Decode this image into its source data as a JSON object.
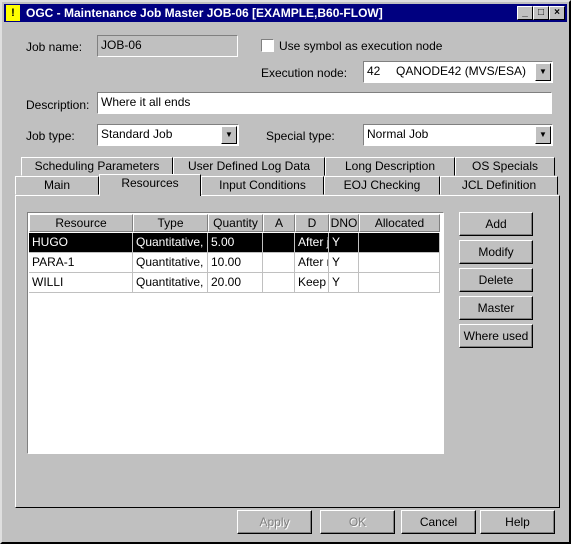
{
  "window": {
    "title": "OGC - Maintenance Job Master JOB-06 [EXAMPLE,B60-FLOW]",
    "app_icon": "!",
    "controls": {
      "minimize": "_",
      "maximize": "□",
      "close": "×"
    }
  },
  "form": {
    "job_name_label": "Job name:",
    "job_name_value": "JOB-06",
    "use_symbol_label": "Use symbol as execution node",
    "use_symbol_checked": false,
    "execution_node_label": "Execution node:",
    "execution_node_number": "42",
    "execution_node_name": "QANODE42 (MVS/ESA)",
    "description_label": "Description:",
    "description_value": "Where it all ends",
    "job_type_label": "Job type:",
    "job_type_value": "Standard Job",
    "special_type_label": "Special type:",
    "special_type_value": "Normal Job"
  },
  "tabs": {
    "back_row": [
      "Scheduling Parameters",
      "User Defined Log Data",
      "Long Description",
      "OS Specials"
    ],
    "front_row": [
      "Main",
      "Resources",
      "Input Conditions",
      "EOJ Checking",
      "JCL Definition"
    ],
    "active": "Resources"
  },
  "table": {
    "columns": [
      "Resource",
      "Type",
      "Quantity",
      "A",
      "D",
      "DNO",
      "Allocated"
    ],
    "rows": [
      [
        "HUGO",
        "Quantitative, n",
        "5.00",
        "",
        "After j",
        "Y",
        ""
      ],
      [
        "PARA-1",
        "Quantitative, r",
        "10.00",
        "",
        "After n",
        "Y",
        ""
      ],
      [
        "WILLI",
        "Quantitative, n",
        "20.00",
        "",
        "Keep",
        "Y",
        ""
      ]
    ],
    "selected_row": 0
  },
  "side_buttons": {
    "add": "Add",
    "modify": "Modify",
    "delete": "Delete",
    "master": "Master",
    "where_used": "Where used"
  },
  "footer_buttons": {
    "apply": "Apply",
    "ok": "OK",
    "cancel": "Cancel",
    "help": "Help"
  },
  "icons": {
    "combo_arrow": "▼"
  }
}
